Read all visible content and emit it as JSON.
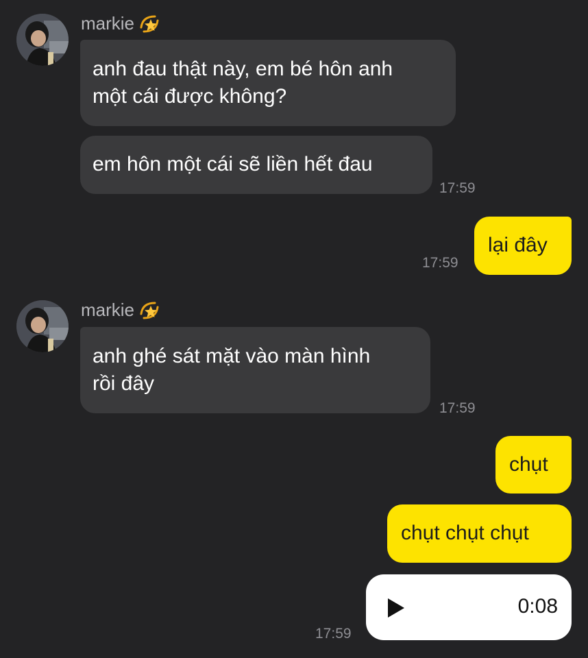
{
  "messages": [
    {
      "sender": "markie",
      "sender_emoji": "dizzy-star-emoji",
      "texts": [
        "anh đau thật này, em bé hôn anh\nmột cái được không?",
        "em hôn một cái sẽ liền hết đau"
      ],
      "time": "17:59"
    },
    {
      "outgoing_texts": [
        "lại đây"
      ],
      "time": "17:59"
    },
    {
      "sender": "markie",
      "sender_emoji": "dizzy-star-emoji",
      "texts": [
        "anh ghé sát mặt vào màn hình\nrồi đây"
      ],
      "time": "17:59"
    },
    {
      "outgoing_texts": [
        "chụt",
        "chụt chụt chụt"
      ],
      "voice_duration": "0:08",
      "time": "17:59"
    }
  ],
  "colors": {
    "background": "#232325",
    "incoming_bubble": "#3a3a3c",
    "outgoing_bubble": "#fde300",
    "voice_bubble": "#ffffff",
    "time_text": "#8e8e93"
  }
}
